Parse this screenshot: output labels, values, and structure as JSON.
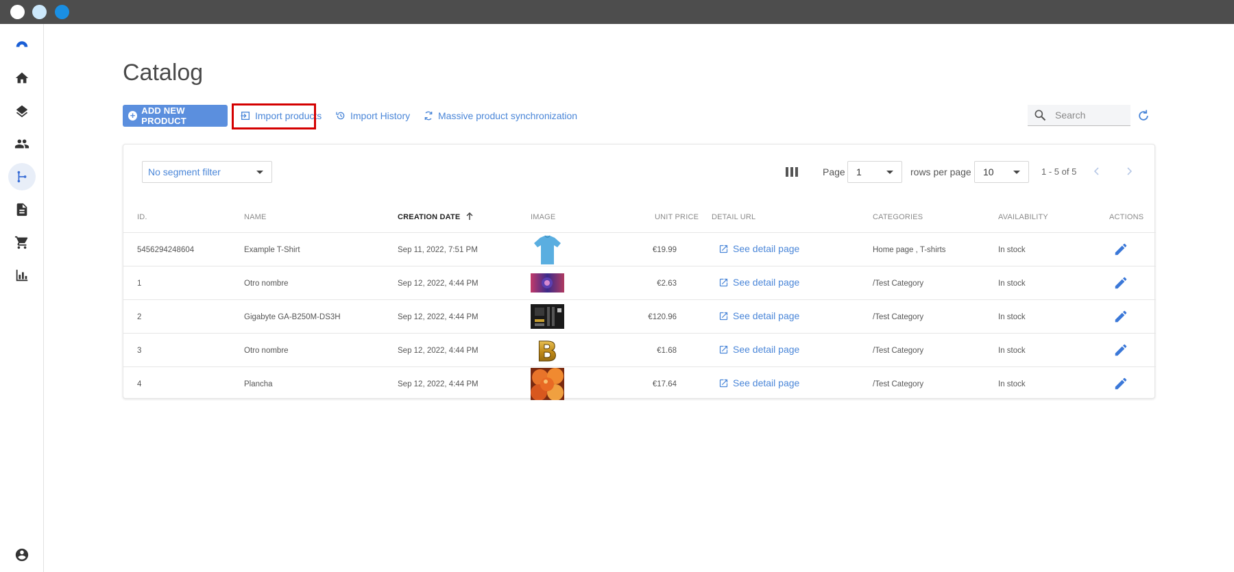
{
  "window": {
    "dots": [
      "#ffffff",
      "#cce8fb",
      "#1a8fe3"
    ]
  },
  "sidebar": {
    "items": [
      {
        "icon": "logo-icon"
      },
      {
        "icon": "home-icon"
      },
      {
        "icon": "layers-icon"
      },
      {
        "icon": "people-icon"
      },
      {
        "icon": "flow-icon",
        "active": true
      },
      {
        "icon": "document-icon"
      },
      {
        "icon": "cart-icon"
      },
      {
        "icon": "chart-icon"
      },
      {
        "icon": "account-icon"
      }
    ]
  },
  "page": {
    "title": "Catalog"
  },
  "toolbar": {
    "add_label": "ADD NEW PRODUCT",
    "import_label": "Import products",
    "history_label": "Import History",
    "sync_label": "Massive product synchronization",
    "search_placeholder": "Search"
  },
  "filters": {
    "segment": "No segment filter",
    "page_label": "Page",
    "page_value": "1",
    "rows_label": "rows per page",
    "rows_value": "10",
    "range": "1 - 5 of 5"
  },
  "table": {
    "headers": {
      "id": "ID.",
      "name": "NAME",
      "date": "CREATION DATE",
      "image": "IMAGE",
      "price": "UNIT PRICE",
      "url": "DETAIL URL",
      "categories": "CATEGORIES",
      "availability": "AVAILABILITY",
      "actions": "ACTIONS"
    },
    "rows": [
      {
        "id": "5456294248604",
        "name": "Example T-Shirt",
        "date": "Sep 11, 2022, 7:51 PM",
        "image": "tshirt",
        "price": "€19.99",
        "link": "See detail page",
        "categories": "Home page , T-shirts",
        "availability": "In stock"
      },
      {
        "id": "1",
        "name": "Otro nombre",
        "date": "Sep 12, 2022, 4:44 PM",
        "image": "banner",
        "price": "€2.63",
        "link": "See detail page",
        "categories": "/Test Category",
        "availability": "In stock"
      },
      {
        "id": "2",
        "name": "Gigabyte GA-B250M-DS3H",
        "date": "Sep 12, 2022, 4:44 PM",
        "image": "motherboard",
        "price": "€120.96",
        "link": "See detail page",
        "categories": "/Test Category",
        "availability": "In stock"
      },
      {
        "id": "3",
        "name": "Otro nombre",
        "date": "Sep 12, 2022, 4:44 PM",
        "image": "letter-b",
        "price": "€1.68",
        "link": "See detail page",
        "categories": "/Test Category",
        "availability": "In stock"
      },
      {
        "id": "4",
        "name": "Plancha",
        "date": "Sep 12, 2022, 4:44 PM",
        "image": "peaches",
        "price": "€17.64",
        "link": "See detail page",
        "categories": "/Test Category",
        "availability": "In stock"
      }
    ]
  }
}
